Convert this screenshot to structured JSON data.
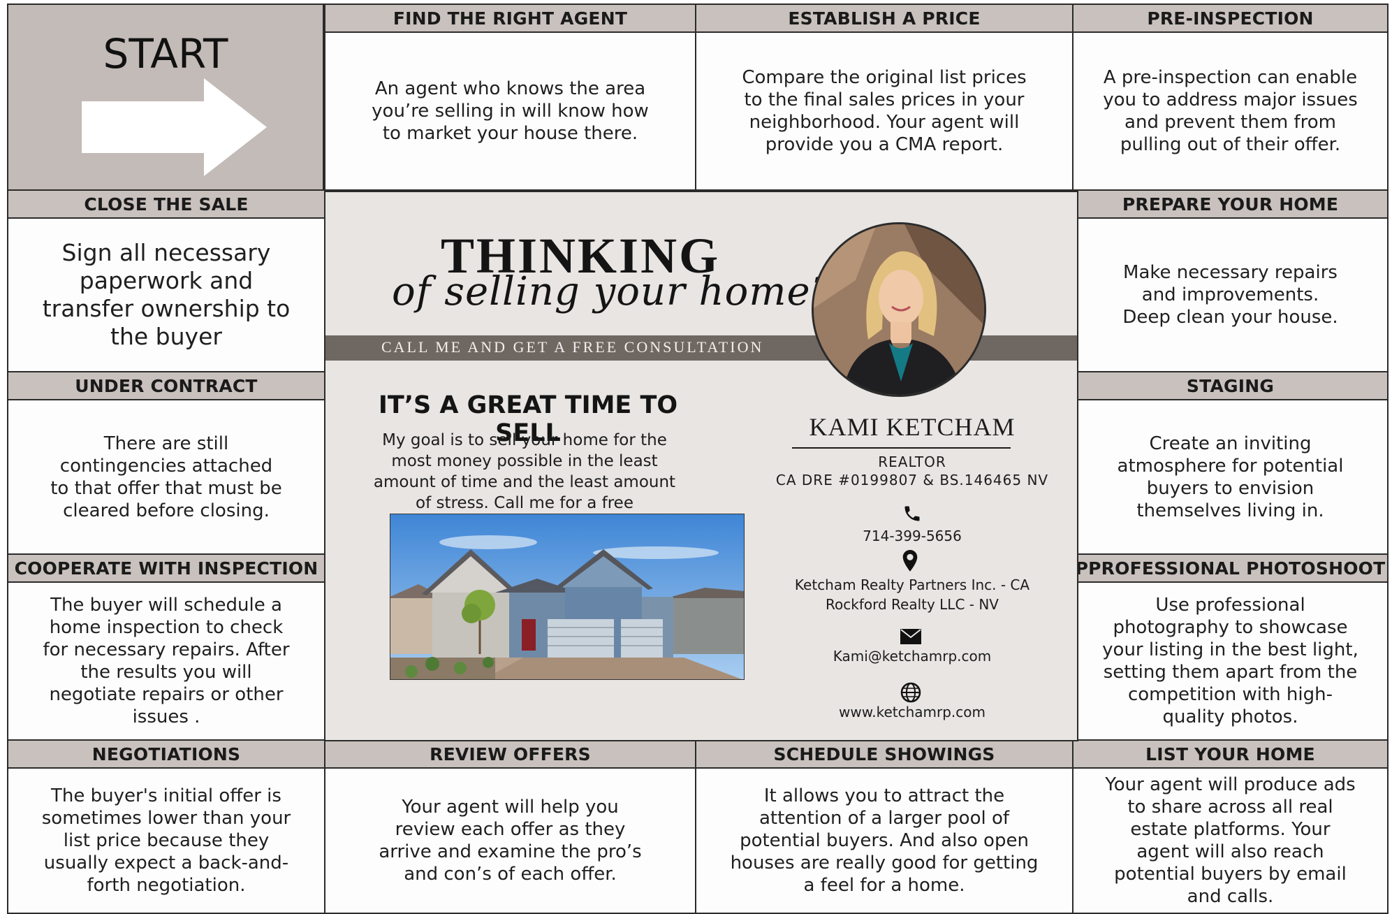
{
  "start_label": "START",
  "cells": {
    "find_agent": {
      "title": "FIND THE RIGHT AGENT",
      "body": "An agent who knows the area you’re selling in will know how to market your house there."
    },
    "establish_price": {
      "title": "ESTABLISH A PRICE",
      "body": "Compare the original list prices to the final sales prices in your neighborhood. Your agent will provide you a CMA report."
    },
    "pre_inspection": {
      "title": "PRE-INSPECTION",
      "body": "A pre-inspection can enable you to address major issues and prevent them from pulling out of their offer."
    },
    "close_sale": {
      "title": "CLOSE THE SALE",
      "body": "Sign all necessary paperwork and transfer ownership to the buyer"
    },
    "prepare_home": {
      "title": "PREPARE YOUR HOME",
      "body": "Make necessary repairs and improvements. Deep clean your house."
    },
    "under_contract": {
      "title": "UNDER CONTRACT",
      "body": "There are still contingencies attached to that offer that must be cleared before closing."
    },
    "staging": {
      "title": "STAGING",
      "body": "Create an inviting atmosphere for potential buyers to envision themselves living in."
    },
    "cooperate_inspection": {
      "title": "COOPERATE WITH INSPECTION",
      "body": "The buyer will schedule a home inspection to check for necessary repairs. After the results you will negotiate repairs or other issues ."
    },
    "photoshoot": {
      "title": "PPROFESSIONAL PHOTOSHOOT",
      "body": "Use professional photography to showcase your listing in the best light, setting them apart from the competition with high-quality photos."
    },
    "negotiations": {
      "title": "NEGOTIATIONS",
      "body": "The buyer's initial offer is sometimes lower than your list price because they usually expect a back-and-forth negotiation."
    },
    "review_offers": {
      "title": "REVIEW OFFERS",
      "body": "Your agent will help you review each offer as they arrive and examine the pro’s and con’s of each offer."
    },
    "schedule_showings": {
      "title": "SCHEDULE SHOWINGS",
      "body": "It allows you to attract the attention of a larger pool of potential buyers. And also open houses are really good for getting a feel for a home."
    },
    "list_home": {
      "title": "LIST YOUR HOME",
      "body": "Your agent will produce ads to share across all real estate platforms. Your agent will also reach potential buyers by email and calls."
    }
  },
  "center": {
    "headline": "THINKING",
    "script_line": "of selling your home?",
    "band_text": "CALL ME AND GET A FREE  CONSULTATION",
    "subheading": "IT’S A GREAT TIME TO SELL",
    "goal_text": "My goal is to sell your home for the most money possible in the least amount of time and the least amount of stress. Call me for a free consultation.",
    "agent_name": "KAMI KETCHAM",
    "role": "REALTOR",
    "license": "CA DRE #0199807 & BS.146465 NV",
    "phone": "714-399-5656",
    "company_ca": "Ketcham Realty Partners Inc. - CA",
    "company_nv": "Rockford Realty LLC - NV",
    "email": "Kami@ketchamrp.com",
    "website": "www.ketchamrp.com"
  },
  "icons": [
    "arrow-right-icon",
    "phone-icon",
    "location-pin-icon",
    "envelope-icon",
    "globe-icon"
  ],
  "colors": {
    "header_bg": "#c9c1bd",
    "start_bg": "#c3bbb7",
    "center_bg": "#e8e5e3",
    "band_bg": "#6f6762"
  }
}
